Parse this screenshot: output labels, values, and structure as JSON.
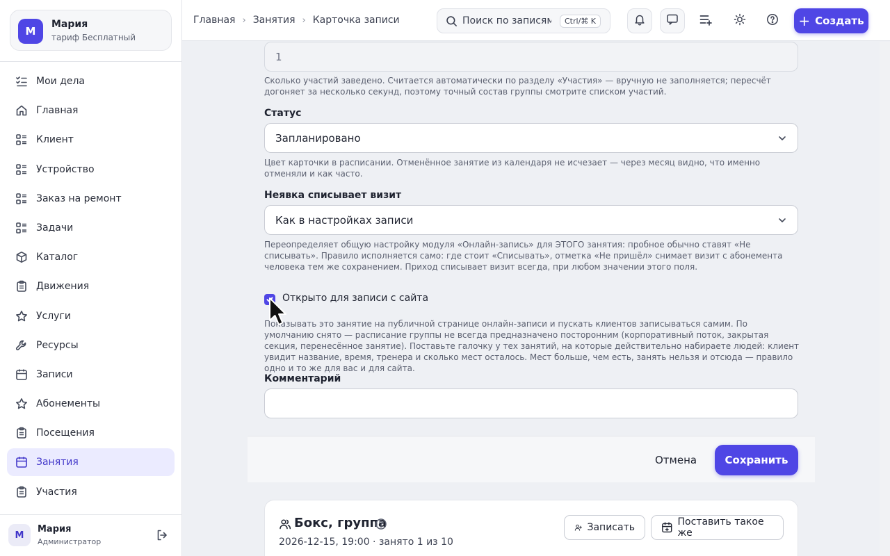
{
  "account": {
    "avatar_letter": "М",
    "name": "Мария",
    "plan": "тариф Бесплатный"
  },
  "sidebar": {
    "items": [
      {
        "label": "Мои дела",
        "icon": "checklist-icon"
      },
      {
        "label": "Главная",
        "icon": "home-icon"
      },
      {
        "label": "Клиент",
        "icon": "list-icon"
      },
      {
        "label": "Устройство",
        "icon": "list-icon"
      },
      {
        "label": "Заказ на ремонт",
        "icon": "list-icon"
      },
      {
        "label": "Задачи",
        "icon": "list-icon"
      },
      {
        "label": "Каталог",
        "icon": "box-icon"
      },
      {
        "label": "Движения",
        "icon": "clipboard-icon"
      },
      {
        "label": "Услуги",
        "icon": "star-icon"
      },
      {
        "label": "Ресурсы",
        "icon": "wrench-icon"
      },
      {
        "label": "Записи",
        "icon": "calendar-icon"
      },
      {
        "label": "Абонементы",
        "icon": "star-icon"
      },
      {
        "label": "Посещения",
        "icon": "clipboard-icon"
      },
      {
        "label": "Занятия",
        "icon": "calendar-icon",
        "active": true
      },
      {
        "label": "Участия",
        "icon": "clipboard-icon"
      }
    ]
  },
  "user": {
    "avatar_letter": "М",
    "name": "Мария",
    "role": "Администратор"
  },
  "breadcrumb": [
    "Главная",
    "Занятия",
    "Карточка записи"
  ],
  "search": {
    "placeholder": "Поиск по записям",
    "shortcut": "Ctrl/⌘ K"
  },
  "header": {
    "create_label": "Создать"
  },
  "form": {
    "count_value": "1",
    "count_hint": "Сколько участий заведено. Считается автоматически по разделу «Участия» — вручную не заполняется; пересчёт догоняет за несколько секунд, поэтому точный состав группы смотрите списком участий.",
    "status_label": "Статус",
    "status_value": "Запланировано",
    "status_hint": "Цвет карточки в расписании. Отменённое занятие из календаря не исчезает — через месяц видно, что именно отменяли и как часто.",
    "noshow_label": "Неявка списывает визит",
    "noshow_value": "Как в настройках записи",
    "noshow_hint": "Переопределяет общую настройку модуля «Онлайн-запись» для ЭТОГО занятия: пробное обычно ставят «Не списывать». Правило исполняется само: где стоит «Списывать», отметка «Не пришёл» снимает визит с абонемента человека тем же сохранением. Приход списывает визит всегда, при любом значении этого поля.",
    "open_label": "Открыто для записи с сайта",
    "open_checked": true,
    "open_hint": "Показывать это занятие на публичной странице онлайн-записи и пускать клиентов записываться самим. По умолчанию снято — расписание группы не всегда предназначено посторонним (корпоративный поток, закрытая секция, перенесённое занятие). Поставьте галочку у тех занятий, на которые действительно набираете людей: клиент увидит название, время, тренера и сколько мест осталось. Мест больше, чем есть, занять нельзя и отсюда — правило одно и то же для вас и для сайта.",
    "comment_label": "Комментарий",
    "comment_value": ""
  },
  "actions": {
    "cancel_label": "Отмена",
    "save_label": "Сохранить"
  },
  "card": {
    "title": "Бокс, группа",
    "subtitle": "2026-12-15, 19:00 · занято 1 из 10",
    "enroll_label": "Записать",
    "duplicate_label": "Поставить такое же"
  },
  "colors": {
    "accent": "#4f46e5",
    "active_bg": "#ebebff"
  }
}
